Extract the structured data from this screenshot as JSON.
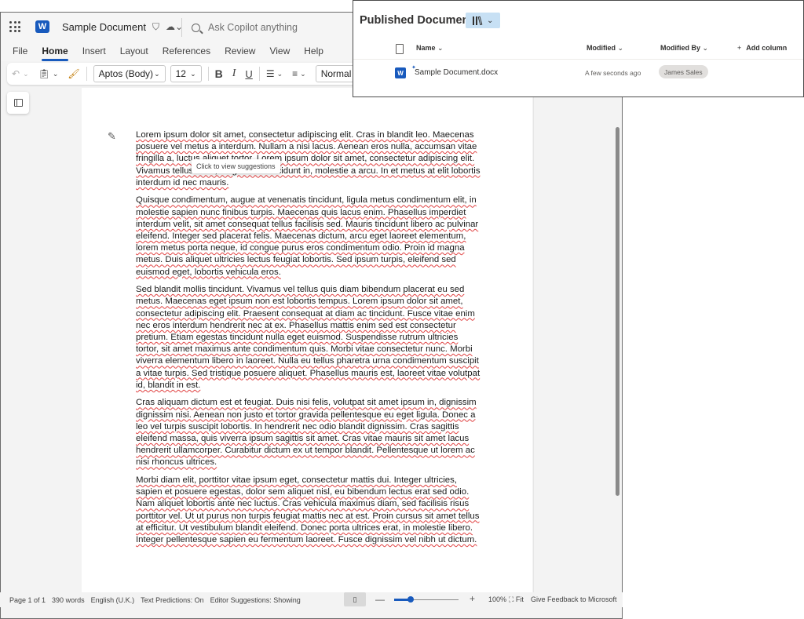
{
  "word": {
    "title": "Sample Document",
    "copilot_placeholder": "Ask Copilot anything",
    "menu": [
      "File",
      "Home",
      "Insert",
      "Layout",
      "References",
      "Review",
      "View",
      "Help"
    ],
    "active_menu": "Home",
    "ribbon": {
      "font_name": "Aptos (Body)",
      "font_size": "12",
      "style": "Normal",
      "bold": "B",
      "italic": "I",
      "underline": "U"
    },
    "tooltip": "Click to view suggestions",
    "paragraphs": [
      "Lorem ipsum dolor sit amet, consectetur adipiscing elit. Cras in blandit leo. Maecenas posuere vel metus a interdum. Nullam a nisi lacus. Aenean eros nulla, accumsan vitae fringilla a, luctus aliquet tortor. Lorem ipsum dolor sit amet, consectetur adipiscing elit. Vivamus tellus risus, fringilla sed tincidunt in, molestie a arcu. In et metus at elit lobortis interdum id nec mauris.",
      "Quisque condimentum, augue at venenatis tincidunt, ligula metus condimentum elit, in molestie sapien nunc finibus turpis. Maecenas quis lacus enim. Phasellus imperdiet interdum velit, sit amet consequat tellus facilisis sed. Mauris tincidunt libero ac pulvinar eleifend. Integer sed placerat felis. Maecenas dictum, arcu eget laoreet elementum, lorem metus porta neque, id congue purus eros condimentum odio. Proin id magna metus. Duis aliquet ultricies lectus feugiat lobortis. Sed ipsum turpis, eleifend sed euismod eget, lobortis vehicula eros.",
      "Sed blandit mollis tincidunt. Vivamus vel tellus quis diam bibendum placerat eu sed metus. Maecenas eget ipsum non est lobortis tempus. Lorem ipsum dolor sit amet, consectetur adipiscing elit. Praesent consequat at diam ac tincidunt. Fusce vitae enim nec eros interdum hendrerit nec at ex. Phasellus mattis enim sed est consectetur pretium. Etiam egestas tincidunt nulla eget euismod. Suspendisse rutrum ultricies tortor, sit amet maximus ante condimentum quis. Morbi vitae consectetur nunc. Morbi viverra elementum libero in laoreet. Nulla eu tellus pharetra urna condimentum suscipit a vitae turpis. Sed tristique posuere aliquet. Phasellus mauris est, laoreet vitae volutpat id, blandit in est.",
      "Cras aliquam dictum est et feugiat. Duis nisi felis, volutpat sit amet ipsum in, dignissim dignissim nisi. Aenean non justo et tortor gravida pellentesque eu eget ligula. Donec a leo vel turpis suscipit lobortis. In hendrerit nec odio blandit dignissim. Cras sagittis eleifend massa, quis viverra ipsum sagittis sit amet. Cras vitae mauris sit amet lacus hendrerit ullamcorper. Curabitur dictum ex ut tempor blandit. Pellentesque ut lorem ac nisi rhoncus ultrices.",
      "Morbi diam elit, porttitor vitae ipsum eget, consectetur mattis dui. Integer ultricies, sapien et posuere egestas, dolor sem aliquet nisl, eu bibendum lectus erat sed odio. Nam aliquet lobortis ante nec luctus. Cras vehicula maximus diam, sed facilisis risus porttitor vel. Ut ut purus non turpis feugiat mattis nec at est. Proin cursus sit amet tellus at efficitur. Ut vestibulum blandit eleifend. Donec porta ultrices erat, in molestie libero. Integer pellentesque sapien eu fermentum laoreet. Fusce dignissim vel nibh ut dictum."
    ],
    "status": {
      "page": "Page 1 of 1",
      "words": "390 words",
      "language": "English (U.K.)",
      "predictions": "Text Predictions: On",
      "editor": "Editor Suggestions: Showing",
      "zoom_pct": "100%",
      "zoom_fraction": 0.25,
      "fit": "Fit",
      "feedback": "Give Feedback to Microsoft"
    }
  },
  "published": {
    "title": "Published Documents",
    "columns": {
      "name": "Name",
      "modified": "Modified",
      "modified_by": "Modified By",
      "add": "Add column"
    },
    "rows": [
      {
        "name": "Sample Document.docx",
        "modified": "A few seconds ago",
        "modified_by": "James Sales"
      }
    ]
  },
  "icons": {
    "app_launcher": "waffle-icon",
    "word_logo": "word-logo-icon",
    "accent_color": "#185abd"
  }
}
